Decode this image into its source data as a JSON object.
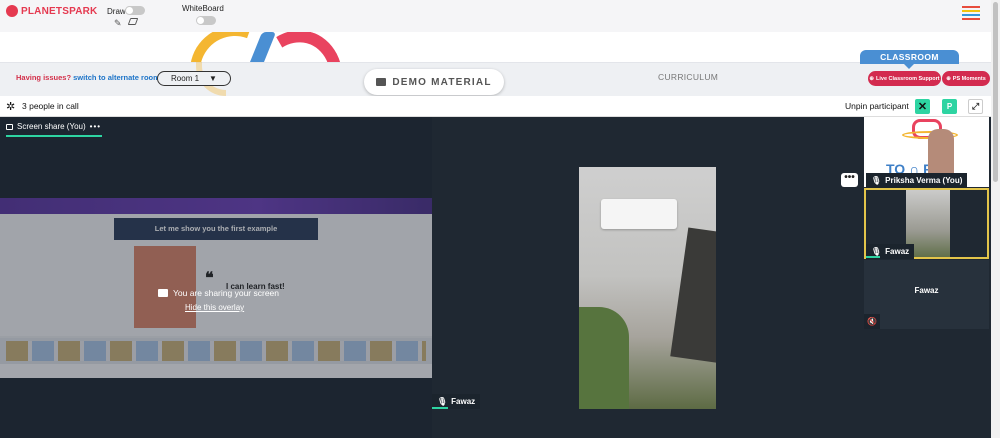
{
  "topbar": {
    "logo_text": "PLANETSPARK",
    "draw_label": "Draw",
    "whiteboard_label": "WhiteBoard",
    "menu_colors": [
      "#e74c3c",
      "#f1c40f",
      "#3498db",
      "#e74c3c"
    ]
  },
  "banner": {
    "issues_label": "Having issues?",
    "switch_link": "switch to alternate room",
    "room_selected": "Room 1",
    "demo_material_label": "DEMO MATERIAL",
    "curriculum_label": "CURRICULUM",
    "classroom_label": "CLASSROOM",
    "live_support_label": "Live Classroom Support",
    "ps_moments_label": "PS Moments"
  },
  "callbar": {
    "people_count": "3 people in call",
    "unpin_label": "Unpin participant",
    "p_button": "P"
  },
  "screen_share": {
    "tab_label": "Screen share (You)",
    "sharing_text": "You are sharing your screen",
    "hide_overlay": "Hide this overlay",
    "slide_title": "Let me show you the first example",
    "slide_quote": "I can learn fast!"
  },
  "main_video": {
    "participant": "Fawaz"
  },
  "tiles": [
    {
      "name": "Priksha Verma (You)"
    },
    {
      "name": "Fawaz"
    },
    {
      "name": "Fawaz",
      "muted": true
    }
  ],
  "colors": {
    "accent": "#2ed4a2",
    "brand_red": "#d32b4f",
    "classroom_blue": "#4a8fd3",
    "call_bg": "#1f2832"
  }
}
